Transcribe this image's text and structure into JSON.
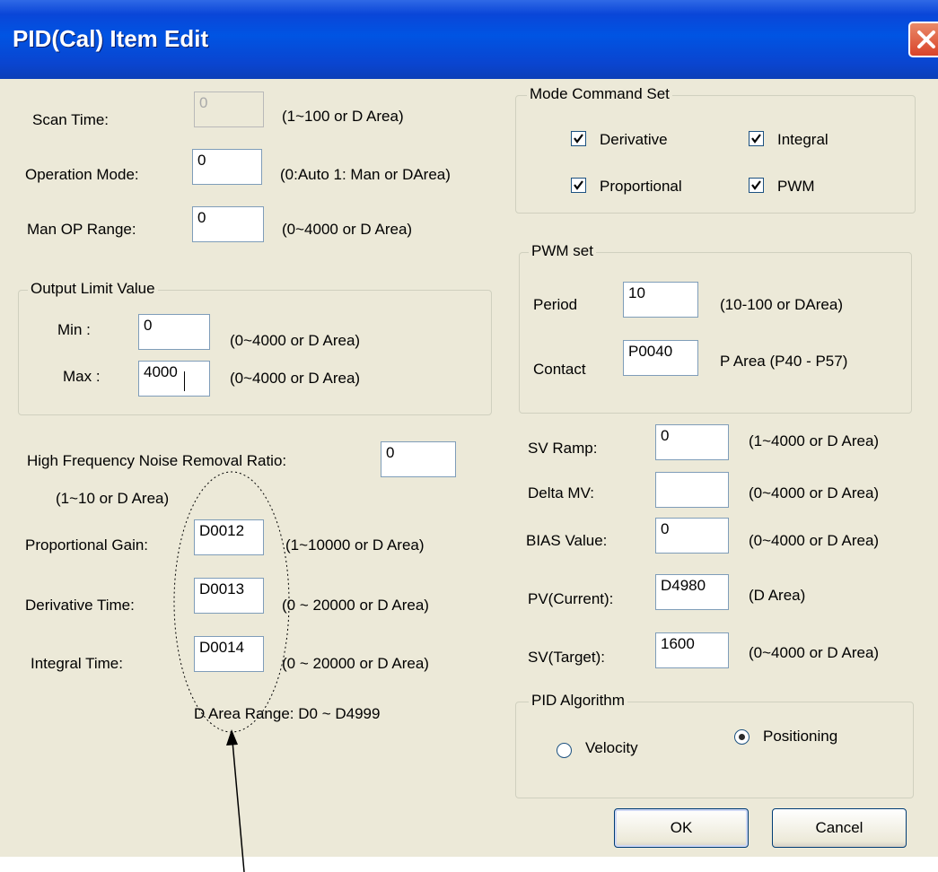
{
  "window": {
    "title": "PID(Cal) Item Edit"
  },
  "left": {
    "scan_time": {
      "label": "Scan Time:",
      "value": "0",
      "hint": "(1~100 or D Area)"
    },
    "operation_mode": {
      "label": "Operation Mode:",
      "value": "0",
      "hint": "(0:Auto 1: Man or DArea)"
    },
    "man_op_range": {
      "label": "Man OP Range:",
      "value": "0",
      "hint": "(0~4000 or D Area)"
    },
    "output_limit": {
      "title": "Output Limit Value",
      "min": {
        "label": "Min :",
        "value": "0",
        "hint": "(0~4000 or D Area)"
      },
      "max": {
        "label": "Max :",
        "value": "4000",
        "hint": "(0~4000 or D Area)"
      }
    },
    "noise": {
      "label": "High Frequency Noise Removal Ratio:",
      "value": "0",
      "hint": "(1~10 or D Area)"
    },
    "proportional_gain": {
      "label": "Proportional Gain:",
      "value": "D0012",
      "hint": "(1~10000  or D Area)"
    },
    "derivative_time": {
      "label": "Derivative Time:",
      "value": "D0013",
      "hint": "(0 ~ 20000 or D Area)"
    },
    "integral_time": {
      "label": "Integral Time:",
      "value": "D0014",
      "hint": "(0 ~ 20000 or D Area)"
    },
    "d_area_range": "D Area Range: D0 ~ D4999"
  },
  "mode_command": {
    "title": "Mode Command Set",
    "items": [
      {
        "label": "Derivative",
        "checked": true
      },
      {
        "label": "Integral",
        "checked": true
      },
      {
        "label": "Proportional",
        "checked": true
      },
      {
        "label": "PWM",
        "checked": true
      }
    ]
  },
  "pwm": {
    "title": "PWM set",
    "period": {
      "label": "Period",
      "value": "10",
      "hint": "(10-100 or DArea)"
    },
    "contact": {
      "label": "Contact",
      "value": "P0040",
      "hint": "P Area (P40 - P57)"
    }
  },
  "right": {
    "sv_ramp": {
      "label": "SV Ramp:",
      "value": "0",
      "hint": "(1~4000 or D Area)"
    },
    "delta_mv": {
      "label": "Delta MV:",
      "value": "",
      "hint": "(0~4000 or D Area)"
    },
    "bias": {
      "label": "BIAS Value:",
      "value": "0",
      "hint": "(0~4000 or D Area)"
    },
    "pv": {
      "label": "PV(Current):",
      "value": "D4980",
      "hint": "(D Area)"
    },
    "sv": {
      "label": "SV(Target):",
      "value": "1600",
      "hint": "(0~4000 or D Area)"
    }
  },
  "algorithm": {
    "title": "PID Algorithm",
    "options": [
      {
        "label": "Velocity",
        "selected": false
      },
      {
        "label": "Positioning",
        "selected": true
      }
    ]
  },
  "buttons": {
    "ok": "OK",
    "cancel": "Cancel"
  },
  "colors": {
    "titlebar": "#0054e3",
    "dialog_bg": "#ece9d8",
    "close": "#d9432a"
  }
}
